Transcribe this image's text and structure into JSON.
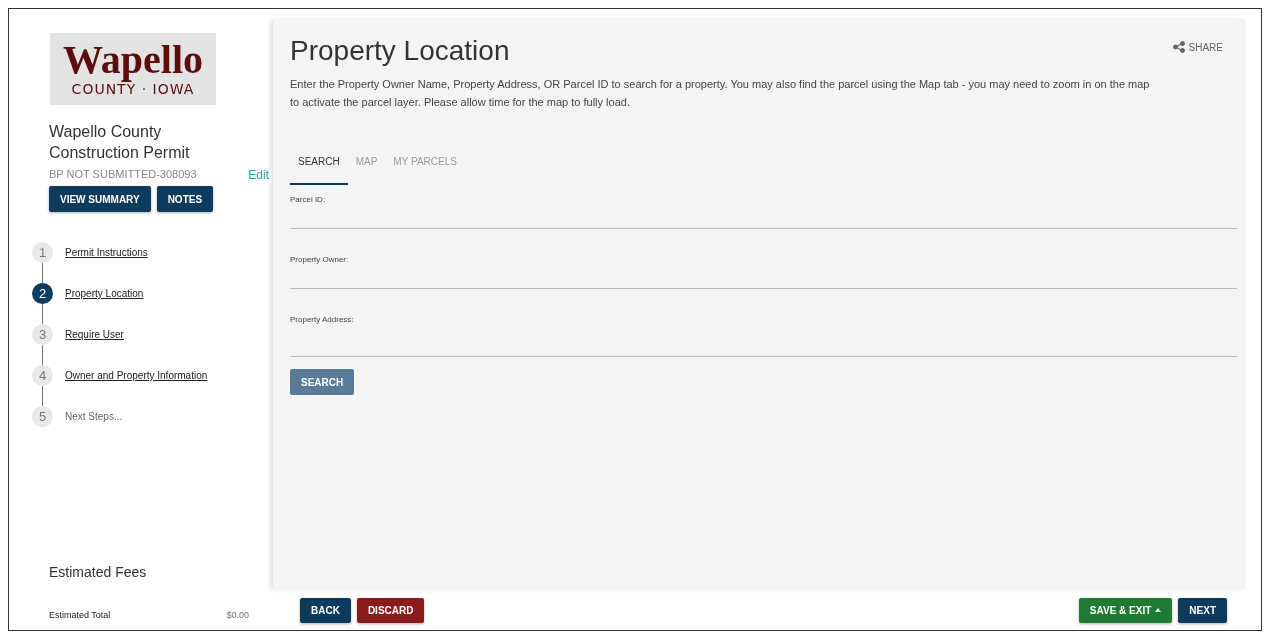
{
  "logo": {
    "name": "Wapello",
    "subtitle": "COUNTY · IOWA"
  },
  "permit": {
    "title": "Wapello County Construction Permit",
    "status": "BP NOT SUBMITTED-308093",
    "edit": "Edit"
  },
  "sidebar_buttons": [
    "VIEW SUMMARY",
    "NOTES"
  ],
  "steps": [
    {
      "number": "1",
      "label": "Permit Instructions",
      "selected": false,
      "disabled": false
    },
    {
      "number": "2",
      "label": "Property Location",
      "selected": true,
      "disabled": false
    },
    {
      "number": "3",
      "label": "Require User",
      "selected": false,
      "disabled": false
    },
    {
      "number": "4",
      "label": "Owner and Property Information",
      "selected": false,
      "disabled": false
    },
    {
      "number": "5",
      "label": "Next Steps...",
      "selected": false,
      "disabled": true
    }
  ],
  "fees": {
    "title": "Estimated Fees",
    "total_label": "Estimated Total",
    "total": "$0.00"
  },
  "page": {
    "title": "Property Location",
    "share": "SHARE",
    "description": "Enter the Property Owner Name, Property Address, OR Parcel ID to search for a property. You may also find the parcel using the Map tab - you may need to zoom in on the map to activate the parcel layer. Please allow time for the map to fully load."
  },
  "tabs": [
    {
      "label": "SEARCH",
      "selected": true
    },
    {
      "label": "MAP",
      "selected": false
    },
    {
      "label": "MY PARCELS",
      "selected": false
    }
  ],
  "fields": [
    {
      "label": "Parcel ID:"
    },
    {
      "label": "Property Owner:"
    },
    {
      "label": "Property Address:"
    }
  ],
  "search_button": {
    "label": "SEARCH",
    "disabled": true
  },
  "footer": {
    "left": [
      {
        "label": "BACK",
        "kind": "primary"
      },
      {
        "label": "DISCARD",
        "kind": "danger"
      }
    ],
    "right": [
      {
        "label": "SAVE & EXIT",
        "kind": "success",
        "dropdown": true
      },
      {
        "label": "NEXT",
        "kind": "primary",
        "dropdown": false
      }
    ]
  }
}
